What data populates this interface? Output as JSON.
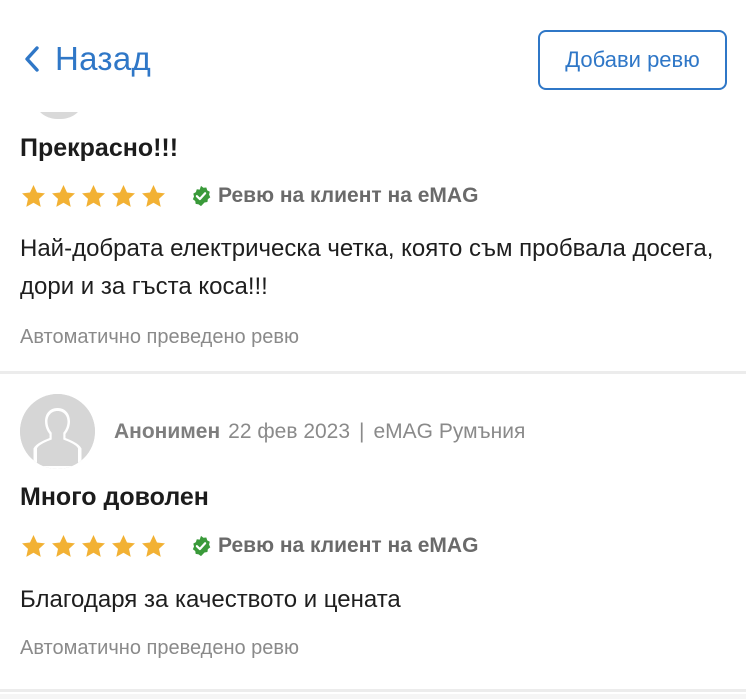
{
  "header": {
    "back_label": "Назад",
    "add_review_label": "Добави ревю"
  },
  "colors": {
    "accent": "#2f77c7",
    "star": "#f2b134",
    "verified": "#3a9a3a",
    "muted": "#8a8a8a"
  },
  "reviews": [
    {
      "title": "Прекрасно!!!",
      "rating": 5,
      "verified_label": "Ревю на клиент на eMAG",
      "body": "Най-добрата електрическа четка, която съм пробвала досега, дори и за гъста коса!!!",
      "translated_label": "Автоматично преведено ревю"
    },
    {
      "author": "Анонимен",
      "date": "22 фев 2023",
      "separator": "|",
      "source": "eMAG Румъния",
      "title": "Много доволен",
      "rating": 5,
      "verified_label": "Ревю на клиент на eMAG",
      "body": "Благодаря за качеството и цената",
      "translated_label": "Автоматично преведено ревю"
    }
  ]
}
